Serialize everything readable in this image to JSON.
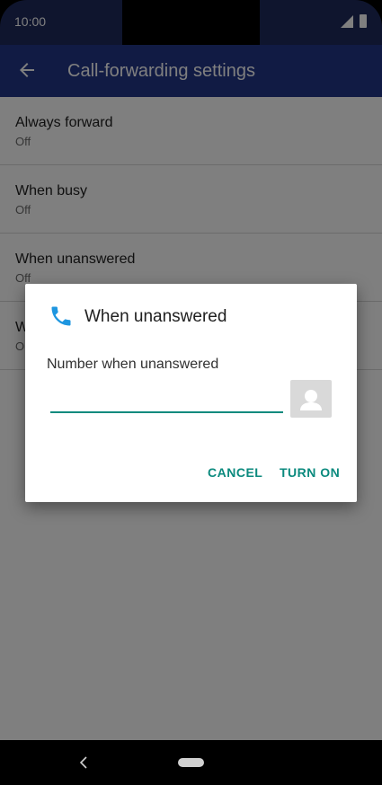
{
  "status_bar": {
    "time": "10:00"
  },
  "app_bar": {
    "title": "Call-forwarding settings"
  },
  "list": {
    "items": [
      {
        "title": "Always forward",
        "subtitle": "Off"
      },
      {
        "title": "When busy",
        "subtitle": "Off"
      },
      {
        "title": "When unanswered",
        "subtitle": "Off"
      },
      {
        "title": "W",
        "subtitle": "O"
      }
    ]
  },
  "dialog": {
    "title": "When unanswered",
    "field_label": "Number when unanswered",
    "input_value": "",
    "cancel_label": "CANCEL",
    "turn_on_label": "TURN ON",
    "accent_color": "#0b8a7e",
    "icons": {
      "title_icon": "phone-icon",
      "contact_icon": "contact-picker-icon"
    }
  },
  "colors": {
    "app_bar": "#233689",
    "accent": "#0b8a7e"
  }
}
